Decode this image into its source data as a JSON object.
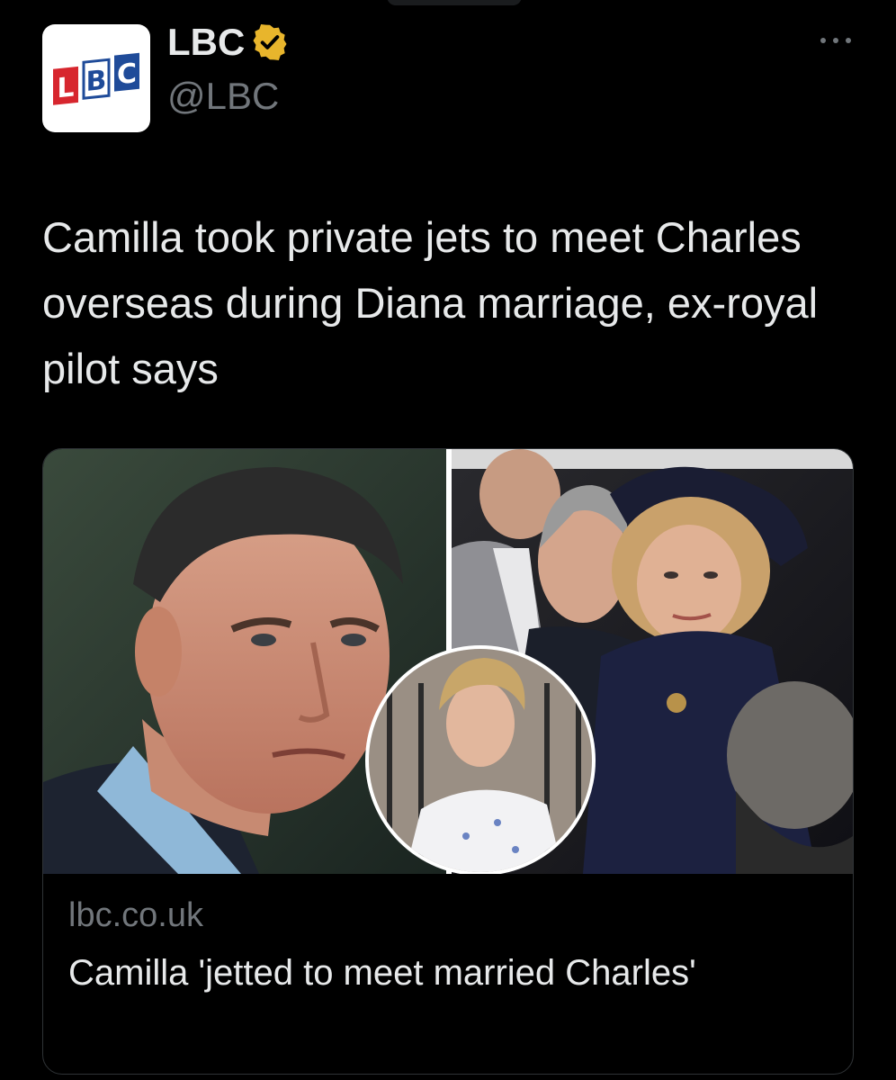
{
  "account": {
    "logo_text": "LBC",
    "display_name": "LBC",
    "handle": "@LBC",
    "verified_icon": "verified-badge-gold",
    "more_icon": "more-horizontal-icon"
  },
  "tweet": {
    "text": "Camilla took private jets to meet Charles overseas during Diana marriage, ex-royal pilot says"
  },
  "link_card": {
    "domain": "lbc.co.uk",
    "title": "Camilla 'jetted to meet married Charles'",
    "image_description_icon": "photo-collage"
  },
  "colors": {
    "background": "#000000",
    "text_primary": "#e7e9ea",
    "text_secondary": "#71767b",
    "border": "#2f3336",
    "verified_gold": "#e8b52c",
    "logo_red": "#d7262e",
    "logo_blue": "#1f4b99"
  }
}
